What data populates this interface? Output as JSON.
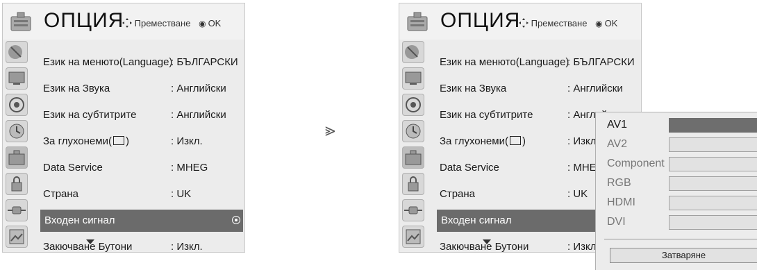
{
  "menu": {
    "title": "ОПЦИЯ",
    "hint_move": "Преместване",
    "hint_ok": "OK",
    "items": [
      {
        "label": "Език на менюто(Language)",
        "value": ": БЪЛГАРСКИ"
      },
      {
        "label": "Език на Звука",
        "value": ": Английски"
      },
      {
        "label": "Език на субтитрите",
        "value": ": Английски"
      },
      {
        "label": "За глухонеми(",
        "label_suffix": ")",
        "value": ": Изкл."
      },
      {
        "label": "Data Service",
        "value": ": MHEG"
      },
      {
        "label": "Страна",
        "value": ": UK"
      },
      {
        "label": "Входен сигнал",
        "value": ""
      },
      {
        "label": "Закючване Бутони",
        "value": ": Изкл."
      }
    ],
    "selected_index": 6,
    "icons": [
      "satellite-dish-icon",
      "tv-screen-icon",
      "speaker-icon",
      "clock-icon",
      "options-icon",
      "lock-icon",
      "plug-icon",
      "photo-album-icon"
    ]
  },
  "transition_symbol": "⪢",
  "input_popup": {
    "options": [
      "AV1",
      "AV2",
      "Component",
      "RGB",
      "HDMI",
      "DVI"
    ],
    "active_option": "AV1",
    "close_label": "Затваряне"
  },
  "colors": {
    "selected_row": "#6b6b6b",
    "menu_bg": "#ececec"
  }
}
